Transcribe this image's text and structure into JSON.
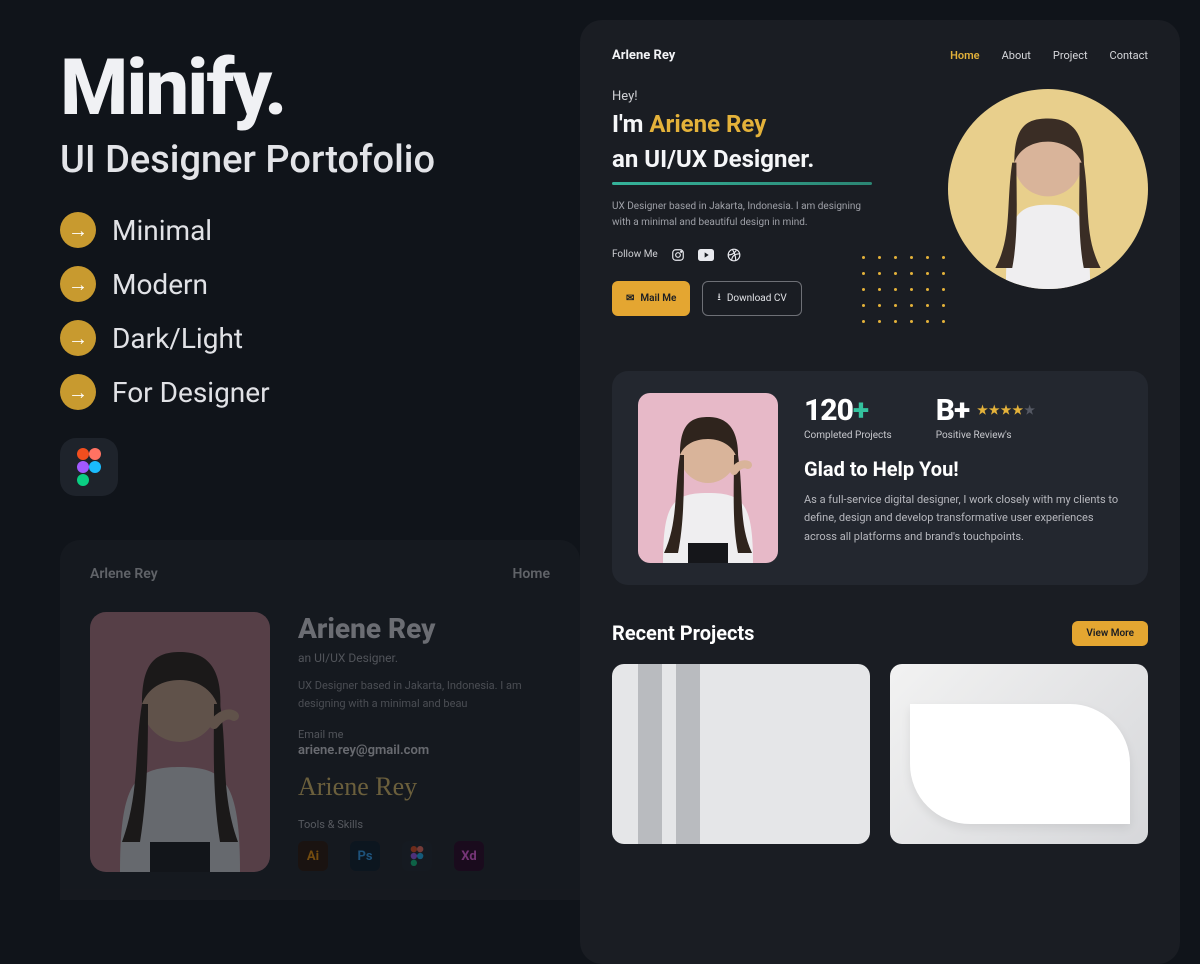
{
  "marketing": {
    "title": "Minify.",
    "subtitle": "UI Designer Portofolio",
    "features": [
      "Minimal",
      "Modern",
      "Dark/Light",
      "For Designer"
    ]
  },
  "preview": {
    "brand": "Arlene Rey",
    "nav": {
      "home": "Home",
      "about": "About",
      "project": "Project",
      "contact": "Contact"
    },
    "hero": {
      "hey": "Hey!",
      "line1_prefix": "I'm ",
      "name": "Ariene  Rey",
      "line2": "an UI/UX Designer.",
      "desc": "UX Designer based in Jakarta, Indonesia.\nI am designing with a minimal and beautiful design in mind.",
      "follow": "Follow Me",
      "mail_btn": "Mail Me",
      "cv_btn": "Download CV"
    },
    "stats": {
      "count": "120",
      "plus": "+",
      "count_label": "Completed Projects",
      "rating": "B+",
      "rating_label": "Positive Review's",
      "glad_title": "Glad to Help You!",
      "glad_desc": "As a full-service digital designer, I work closely with my clients to define, design and develop transformative user experiences across all platforms and brand's touchpoints."
    },
    "recent": {
      "title": "Recent Projects",
      "view_more": "View More"
    }
  },
  "about": {
    "brand": "Arlene Rey",
    "home": "Home",
    "name": "Ariene  Rey",
    "role": "an UI/UX Designer.",
    "desc": "UX Designer based in Jakarta, Indonesia. I am designing with a minimal and beau",
    "email_label": "Email me",
    "email": "ariene.rey@gmail.com",
    "signature": "Ariene Rey",
    "tools_label": "Tools & Skills",
    "tools": {
      "ai": "Ai",
      "ps": "Ps",
      "xd": "Xd"
    }
  }
}
